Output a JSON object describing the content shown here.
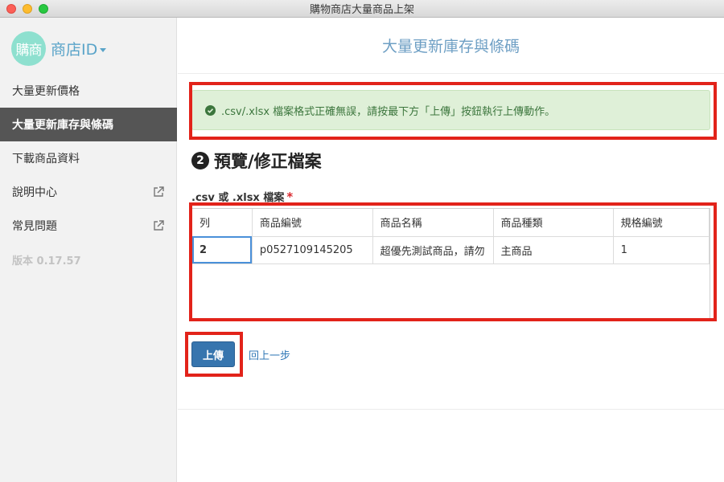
{
  "window": {
    "title": "購物商店大量商品上架"
  },
  "brand": {
    "logo_text": "購商",
    "store_id_label": "商店ID"
  },
  "sidebar": {
    "items": [
      {
        "label": "大量更新價格",
        "active": false,
        "external": false
      },
      {
        "label": "大量更新庫存與條碼",
        "active": true,
        "external": false
      },
      {
        "label": "下載商品資料",
        "active": false,
        "external": false
      },
      {
        "label": "說明中心",
        "active": false,
        "external": true
      },
      {
        "label": "常見問題",
        "active": false,
        "external": true
      }
    ],
    "version": "版本 0.17.57"
  },
  "main": {
    "title": "大量更新庫存與條碼",
    "alert": {
      "type": "success",
      "text": ".csv/.xlsx 檔案格式正確無誤，請按最下方「上傳」按鈕執行上傳動作。"
    },
    "section": {
      "step": "2",
      "title": "預覽/修正檔案"
    },
    "file_label": ".csv 或 .xlsx 檔案",
    "required_mark": "*",
    "table": {
      "headers": [
        "列",
        "商品編號",
        "商品名稱",
        "商品種類",
        "規格編號"
      ],
      "rows": [
        [
          "2",
          "p0527109145205",
          "超優先測試商品，請勿",
          "主商品",
          "1"
        ]
      ]
    },
    "upload_button": "上傳",
    "back_link": "回上一步"
  },
  "colors": {
    "accent": "#3775ae",
    "sidebar_active": "#555555",
    "alert_bg": "#dff0d8",
    "alert_text": "#3c763d",
    "highlight": "#e2231a",
    "brand": "#5aa4c9"
  }
}
